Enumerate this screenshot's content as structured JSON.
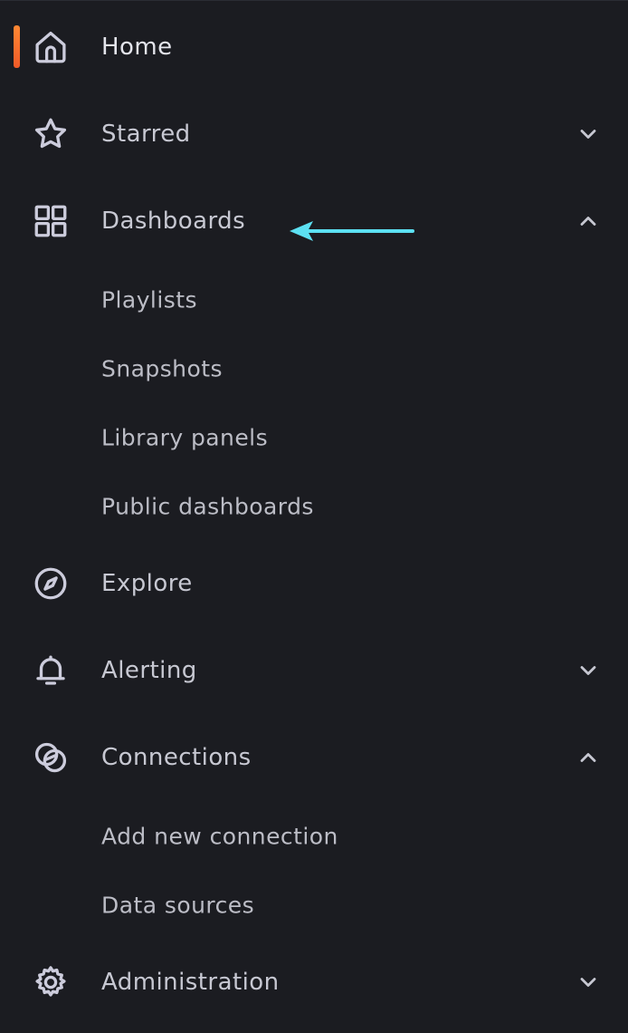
{
  "nav": {
    "home": {
      "label": "Home",
      "icon": "home-icon",
      "active": true
    },
    "starred": {
      "label": "Starred",
      "icon": "star-icon",
      "expanded": false
    },
    "dashboards": {
      "label": "Dashboards",
      "icon": "grid-icon",
      "expanded": true,
      "children": [
        "Playlists",
        "Snapshots",
        "Library panels",
        "Public dashboards"
      ]
    },
    "explore": {
      "label": "Explore",
      "icon": "compass-icon"
    },
    "alerting": {
      "label": "Alerting",
      "icon": "bell-icon",
      "expanded": false
    },
    "connections": {
      "label": "Connections",
      "icon": "connections-icon",
      "expanded": true,
      "children": [
        "Add new connection",
        "Data sources"
      ]
    },
    "administration": {
      "label": "Administration",
      "icon": "gear-icon",
      "expanded": false
    }
  },
  "colors": {
    "background": "#1b1c21",
    "text": "#c7c8d2",
    "active_indicator": "#f05a28",
    "annotation_arrow": "#5ce0f2"
  }
}
